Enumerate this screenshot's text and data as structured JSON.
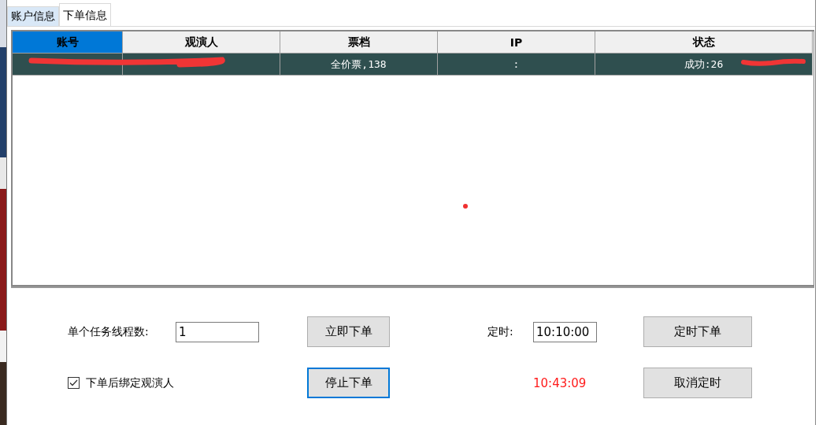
{
  "tabs": [
    {
      "label": "账户信息",
      "selected": false
    },
    {
      "label": "下单信息",
      "selected": true
    }
  ],
  "table": {
    "columns": [
      {
        "label": "账号",
        "selected": true
      },
      {
        "label": "观演人",
        "selected": false
      },
      {
        "label": "票档",
        "selected": false
      },
      {
        "label": "IP",
        "selected": false
      },
      {
        "label": "状态",
        "selected": false
      }
    ],
    "rows": [
      {
        "selected": true,
        "cells": [
          {
            "redacted": true
          },
          {
            "redacted": true
          },
          {
            "text": "全价票,138"
          },
          {
            "text": ":"
          },
          {
            "text": "成功:26",
            "redacted": true
          }
        ]
      }
    ]
  },
  "order_panel": {
    "thread_label": "单个任务线程数:",
    "thread_value": "1",
    "bind_viewer": {
      "label": "下单后绑定观演人",
      "checked": true
    },
    "order_now": {
      "label": "立即下单",
      "focused": false
    },
    "stop_order": {
      "label": "停止下单",
      "focused": true
    },
    "timer_label": "定时:",
    "timer_value": "10:10:00",
    "current_time": "10:43:09",
    "timed_order": {
      "label": "定时下单",
      "focused": false
    },
    "cancel_timer": {
      "label": "取消定时",
      "focused": false
    }
  }
}
